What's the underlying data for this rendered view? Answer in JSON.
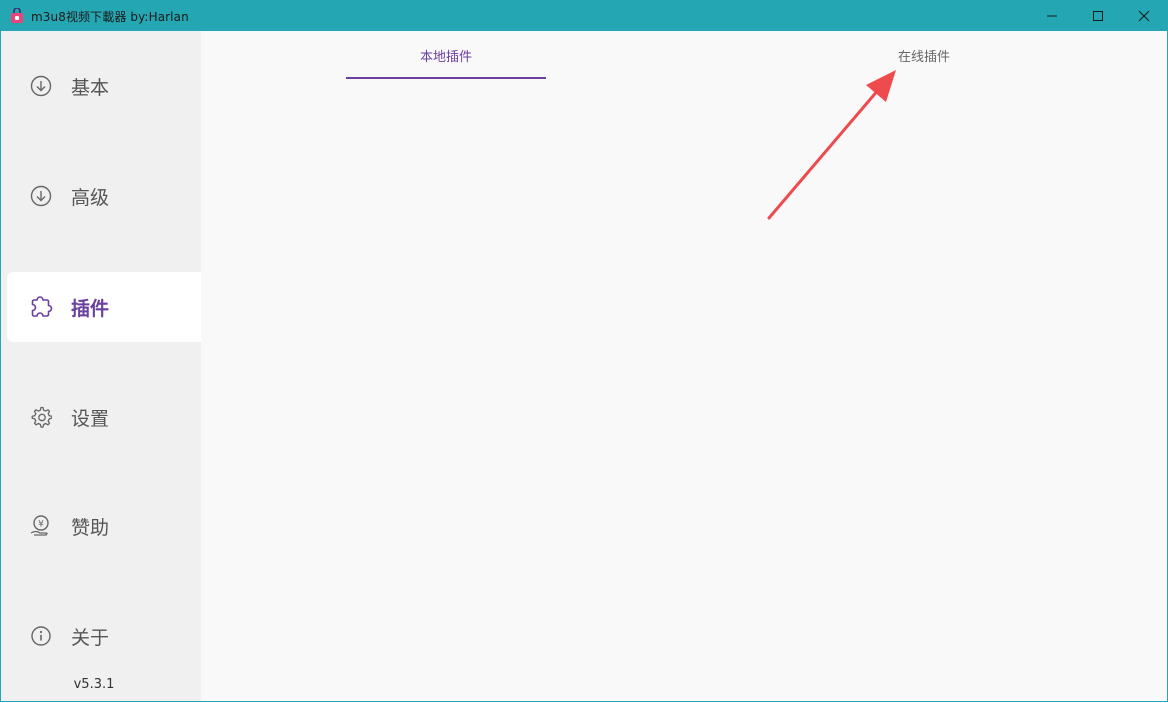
{
  "window": {
    "title": "m3u8视频下載器 by:Harlan",
    "controls": [
      "minimize",
      "maximize",
      "close"
    ]
  },
  "sidebar": {
    "items": [
      {
        "label": "基本",
        "icon": "download-circle-icon"
      },
      {
        "label": "高级",
        "icon": "download-circle-icon"
      },
      {
        "label": "插件",
        "icon": "puzzle-icon",
        "active": true
      },
      {
        "label": "设置",
        "icon": "gear-icon"
      },
      {
        "label": "赞助",
        "icon": "donate-icon"
      },
      {
        "label": "关于",
        "icon": "info-icon"
      }
    ],
    "version": "v5.3.1"
  },
  "tabs": [
    {
      "label": "本地插件",
      "active": true
    },
    {
      "label": "在线插件",
      "active": false
    }
  ],
  "colors": {
    "titlebar": "#24a6b3",
    "accent": "#6a3fa0",
    "annotation_arrow": "#ee4b4f"
  }
}
